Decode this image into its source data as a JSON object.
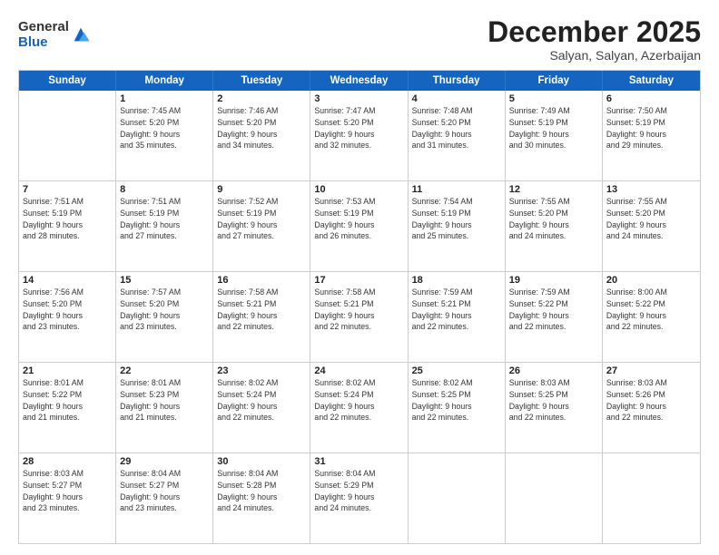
{
  "logo": {
    "general": "General",
    "blue": "Blue"
  },
  "title": "December 2025",
  "subtitle": "Salyan, Salyan, Azerbaijan",
  "weekdays": [
    "Sunday",
    "Monday",
    "Tuesday",
    "Wednesday",
    "Thursday",
    "Friday",
    "Saturday"
  ],
  "rows": [
    [
      {
        "day": "",
        "info": ""
      },
      {
        "day": "1",
        "info": "Sunrise: 7:45 AM\nSunset: 5:20 PM\nDaylight: 9 hours\nand 35 minutes."
      },
      {
        "day": "2",
        "info": "Sunrise: 7:46 AM\nSunset: 5:20 PM\nDaylight: 9 hours\nand 34 minutes."
      },
      {
        "day": "3",
        "info": "Sunrise: 7:47 AM\nSunset: 5:20 PM\nDaylight: 9 hours\nand 32 minutes."
      },
      {
        "day": "4",
        "info": "Sunrise: 7:48 AM\nSunset: 5:20 PM\nDaylight: 9 hours\nand 31 minutes."
      },
      {
        "day": "5",
        "info": "Sunrise: 7:49 AM\nSunset: 5:19 PM\nDaylight: 9 hours\nand 30 minutes."
      },
      {
        "day": "6",
        "info": "Sunrise: 7:50 AM\nSunset: 5:19 PM\nDaylight: 9 hours\nand 29 minutes."
      }
    ],
    [
      {
        "day": "7",
        "info": "Sunrise: 7:51 AM\nSunset: 5:19 PM\nDaylight: 9 hours\nand 28 minutes."
      },
      {
        "day": "8",
        "info": "Sunrise: 7:51 AM\nSunset: 5:19 PM\nDaylight: 9 hours\nand 27 minutes."
      },
      {
        "day": "9",
        "info": "Sunrise: 7:52 AM\nSunset: 5:19 PM\nDaylight: 9 hours\nand 27 minutes."
      },
      {
        "day": "10",
        "info": "Sunrise: 7:53 AM\nSunset: 5:19 PM\nDaylight: 9 hours\nand 26 minutes."
      },
      {
        "day": "11",
        "info": "Sunrise: 7:54 AM\nSunset: 5:19 PM\nDaylight: 9 hours\nand 25 minutes."
      },
      {
        "day": "12",
        "info": "Sunrise: 7:55 AM\nSunset: 5:20 PM\nDaylight: 9 hours\nand 24 minutes."
      },
      {
        "day": "13",
        "info": "Sunrise: 7:55 AM\nSunset: 5:20 PM\nDaylight: 9 hours\nand 24 minutes."
      }
    ],
    [
      {
        "day": "14",
        "info": "Sunrise: 7:56 AM\nSunset: 5:20 PM\nDaylight: 9 hours\nand 23 minutes."
      },
      {
        "day": "15",
        "info": "Sunrise: 7:57 AM\nSunset: 5:20 PM\nDaylight: 9 hours\nand 23 minutes."
      },
      {
        "day": "16",
        "info": "Sunrise: 7:58 AM\nSunset: 5:21 PM\nDaylight: 9 hours\nand 22 minutes."
      },
      {
        "day": "17",
        "info": "Sunrise: 7:58 AM\nSunset: 5:21 PM\nDaylight: 9 hours\nand 22 minutes."
      },
      {
        "day": "18",
        "info": "Sunrise: 7:59 AM\nSunset: 5:21 PM\nDaylight: 9 hours\nand 22 minutes."
      },
      {
        "day": "19",
        "info": "Sunrise: 7:59 AM\nSunset: 5:22 PM\nDaylight: 9 hours\nand 22 minutes."
      },
      {
        "day": "20",
        "info": "Sunrise: 8:00 AM\nSunset: 5:22 PM\nDaylight: 9 hours\nand 22 minutes."
      }
    ],
    [
      {
        "day": "21",
        "info": "Sunrise: 8:01 AM\nSunset: 5:22 PM\nDaylight: 9 hours\nand 21 minutes."
      },
      {
        "day": "22",
        "info": "Sunrise: 8:01 AM\nSunset: 5:23 PM\nDaylight: 9 hours\nand 21 minutes."
      },
      {
        "day": "23",
        "info": "Sunrise: 8:02 AM\nSunset: 5:24 PM\nDaylight: 9 hours\nand 22 minutes."
      },
      {
        "day": "24",
        "info": "Sunrise: 8:02 AM\nSunset: 5:24 PM\nDaylight: 9 hours\nand 22 minutes."
      },
      {
        "day": "25",
        "info": "Sunrise: 8:02 AM\nSunset: 5:25 PM\nDaylight: 9 hours\nand 22 minutes."
      },
      {
        "day": "26",
        "info": "Sunrise: 8:03 AM\nSunset: 5:25 PM\nDaylight: 9 hours\nand 22 minutes."
      },
      {
        "day": "27",
        "info": "Sunrise: 8:03 AM\nSunset: 5:26 PM\nDaylight: 9 hours\nand 22 minutes."
      }
    ],
    [
      {
        "day": "28",
        "info": "Sunrise: 8:03 AM\nSunset: 5:27 PM\nDaylight: 9 hours\nand 23 minutes."
      },
      {
        "day": "29",
        "info": "Sunrise: 8:04 AM\nSunset: 5:27 PM\nDaylight: 9 hours\nand 23 minutes."
      },
      {
        "day": "30",
        "info": "Sunrise: 8:04 AM\nSunset: 5:28 PM\nDaylight: 9 hours\nand 24 minutes."
      },
      {
        "day": "31",
        "info": "Sunrise: 8:04 AM\nSunset: 5:29 PM\nDaylight: 9 hours\nand 24 minutes."
      },
      {
        "day": "",
        "info": ""
      },
      {
        "day": "",
        "info": ""
      },
      {
        "day": "",
        "info": ""
      }
    ]
  ]
}
